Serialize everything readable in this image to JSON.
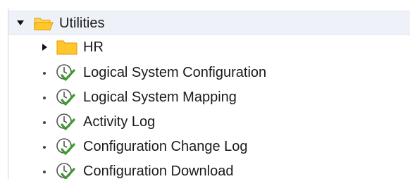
{
  "tree": {
    "root": {
      "label": "Utilities",
      "expanded": true,
      "icon": "folder-open-icon"
    },
    "children": [
      {
        "label": "HR",
        "type": "folder",
        "expanded": false,
        "icon": "folder-icon"
      },
      {
        "label": "Logical System Configuration",
        "type": "transaction",
        "icon": "clock-check-icon"
      },
      {
        "label": "Logical System Mapping",
        "type": "transaction",
        "icon": "clock-check-icon"
      },
      {
        "label": "Activity Log",
        "type": "transaction",
        "icon": "clock-check-icon"
      },
      {
        "label": "Configuration Change Log",
        "type": "transaction",
        "icon": "clock-check-icon"
      },
      {
        "label": "Configuration Download",
        "type": "transaction",
        "icon": "clock-check-icon"
      }
    ]
  },
  "colors": {
    "folder_fill": "#ffc72c",
    "folder_edge": "#e09a00",
    "check_green": "#3c9a2e",
    "selection_bg": "#eef2f8"
  }
}
